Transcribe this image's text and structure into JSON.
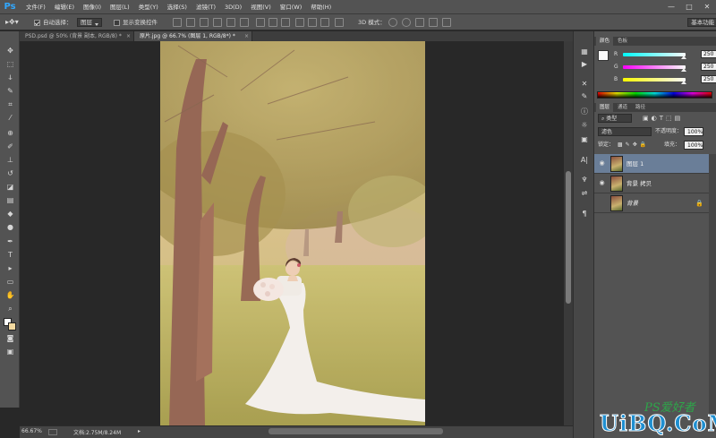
{
  "app": {
    "logo": "Ps"
  },
  "menu": [
    "文件(F)",
    "编辑(E)",
    "图像(I)",
    "图层(L)",
    "类型(Y)",
    "选择(S)",
    "滤镜(T)",
    "3D(D)",
    "视图(V)",
    "窗口(W)",
    "帮助(H)"
  ],
  "window_controls": {
    "minimize": "—",
    "maximize": "□",
    "close": "✕"
  },
  "options": {
    "auto_select_label": "自动选择：",
    "auto_select_checked": true,
    "auto_select_target": "图层",
    "show_transform_label": "显示变换控件",
    "show_transform_checked": false,
    "mode_3d_label": "3D 模式：",
    "workspace": "基本功能"
  },
  "tabs": [
    {
      "label": "PSD.psd @ 50% (背景 副本, RGB/8) *",
      "active": false,
      "close": "×"
    },
    {
      "label": "原片.jpg @ 66.7% (图层 1, RGB/8*) *",
      "active": true,
      "close": "×"
    }
  ],
  "status": {
    "zoom": "66.67%",
    "doc_info": "文档:2.75M/8.24M",
    "arrow": "▸"
  },
  "colors": {
    "accent": "#31a8ff",
    "panel_bg": "#535353",
    "selected_layer": "#6a7e98",
    "foreground_swatch": "#ffffff",
    "background_swatch": "#f2d9a0"
  },
  "color_panel": {
    "tabs": [
      "颜色",
      "色板"
    ],
    "sliders": [
      {
        "label": "R",
        "value": "250",
        "gradient": "linear-gradient(90deg,#00fafa,#fafafa)"
      },
      {
        "label": "G",
        "value": "250",
        "gradient": "linear-gradient(90deg,#fa00fa,#fafafa)"
      },
      {
        "label": "B",
        "value": "250",
        "gradient": "linear-gradient(90deg,#fafa00,#fafafa)"
      }
    ]
  },
  "layers_panel": {
    "tabs": [
      "图层",
      "通道",
      "路径"
    ],
    "filter_kind": "类型",
    "blend_mode": "滤色",
    "opacity_label": "不透明度：",
    "opacity": "100%",
    "lock_label": "锁定：",
    "fill_label": "填充：",
    "fill": "100%",
    "layers": [
      {
        "name": "图层 1",
        "selected": true,
        "visible": true,
        "locked": false
      },
      {
        "name": "背景 拷贝",
        "selected": false,
        "visible": true,
        "locked": false
      },
      {
        "name": "背景",
        "selected": false,
        "visible": false,
        "locked": true
      }
    ]
  },
  "watermark": {
    "logo_text": "PS爱好者",
    "site": "UiBQ.CoM"
  }
}
